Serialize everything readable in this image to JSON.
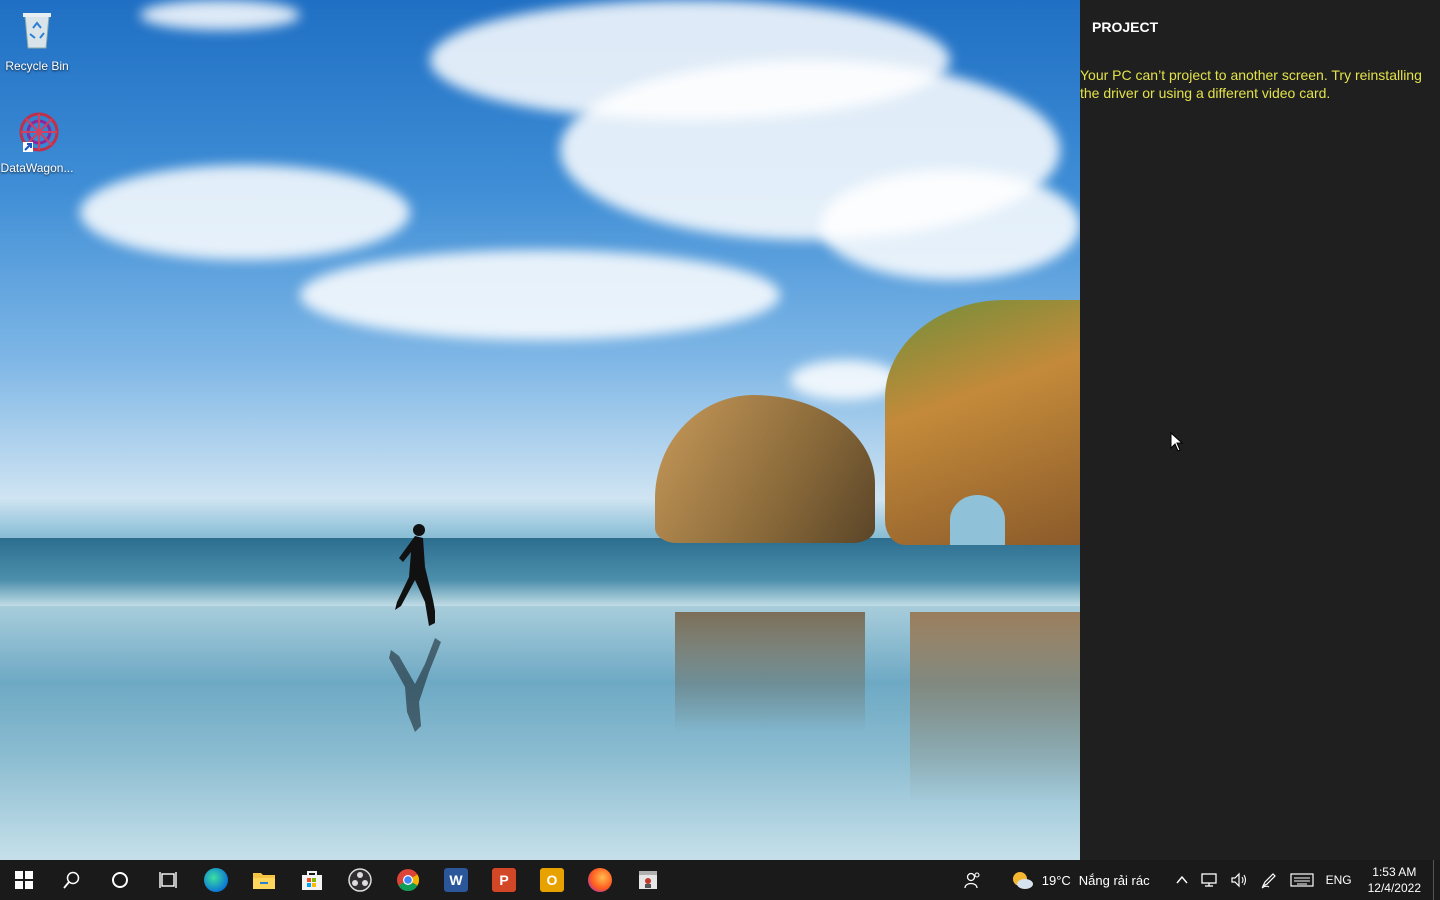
{
  "desktop": {
    "icons": [
      {
        "label": "Recycle Bin",
        "icon": "recycle-bin-icon"
      },
      {
        "label": "DataWagon...",
        "icon": "datawagon-shortcut-icon"
      }
    ]
  },
  "project_panel": {
    "title": "PROJECT",
    "message": "Your PC can’t project to another screen. Try reinstalling the driver or using a different video card.",
    "message_color": "#e3e24a"
  },
  "taskbar": {
    "apps": [
      {
        "name": "Start",
        "icon": "windows-start-icon"
      },
      {
        "name": "Search",
        "icon": "search-icon"
      },
      {
        "name": "Cortana",
        "icon": "cortana-circle-icon"
      },
      {
        "name": "Task View",
        "icon": "task-view-icon"
      },
      {
        "name": "Microsoft Edge",
        "icon": "edge-icon"
      },
      {
        "name": "File Explorer",
        "icon": "file-explorer-icon"
      },
      {
        "name": "Microsoft Store",
        "icon": "store-icon"
      },
      {
        "name": "OBS",
        "icon": "obs-icon"
      },
      {
        "name": "Chrome",
        "icon": "chrome-icon"
      },
      {
        "name": "Word",
        "icon": "word-icon",
        "letter": "W"
      },
      {
        "name": "PowerPoint",
        "icon": "powerpoint-icon",
        "letter": "P"
      },
      {
        "name": "Outlook",
        "icon": "outlook-icon",
        "letter": "O"
      },
      {
        "name": "Firefox",
        "icon": "firefox-icon"
      },
      {
        "name": "App",
        "icon": "app-window-icon"
      }
    ],
    "weather": {
      "temperature": "19°C",
      "condition": "Nắng rải rác"
    },
    "language": "ENG",
    "time": "1:53 AM",
    "date": "12/4/2022"
  }
}
